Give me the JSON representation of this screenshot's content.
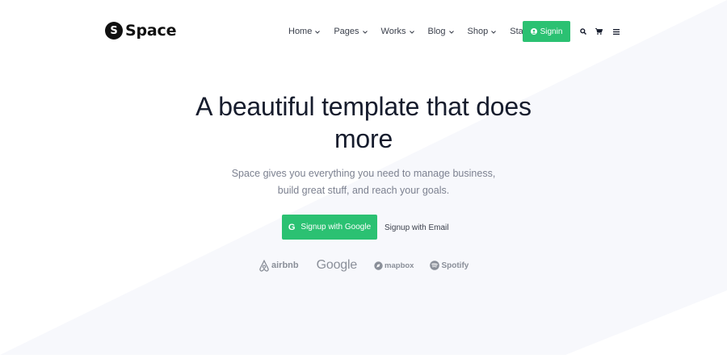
{
  "brand": {
    "mark": "S",
    "name": "Space"
  },
  "nav": {
    "items": [
      {
        "label": "Home",
        "has_menu": true
      },
      {
        "label": "Pages",
        "has_menu": true
      },
      {
        "label": "Works",
        "has_menu": true
      },
      {
        "label": "Blog",
        "has_menu": true
      },
      {
        "label": "Shop",
        "has_menu": true
      },
      {
        "label": "Starter",
        "has_menu": false
      }
    ],
    "signin_label": "Signin",
    "caret": "⌄"
  },
  "hero": {
    "title": "A beautiful template that does more",
    "subtitle": "Space gives you everything you need to manage business, build great stuff, and reach your goals.",
    "primary_cta": "Signup with Google",
    "primary_cta_icon": "G",
    "secondary_cta": "Signup with Email"
  },
  "logos": [
    "airbnb",
    "Google",
    "mapbox",
    "Spotify"
  ],
  "colors": {
    "accent": "#2bc172",
    "text": "#161c2d",
    "muted": "#7c8190",
    "bg_shape": "#f7f8fc"
  },
  "icons": [
    "user-circle-icon",
    "search-icon",
    "cart-icon",
    "menu-icon",
    "google-g-icon",
    "airbnb-icon",
    "mapbox-icon",
    "spotify-icon"
  ]
}
